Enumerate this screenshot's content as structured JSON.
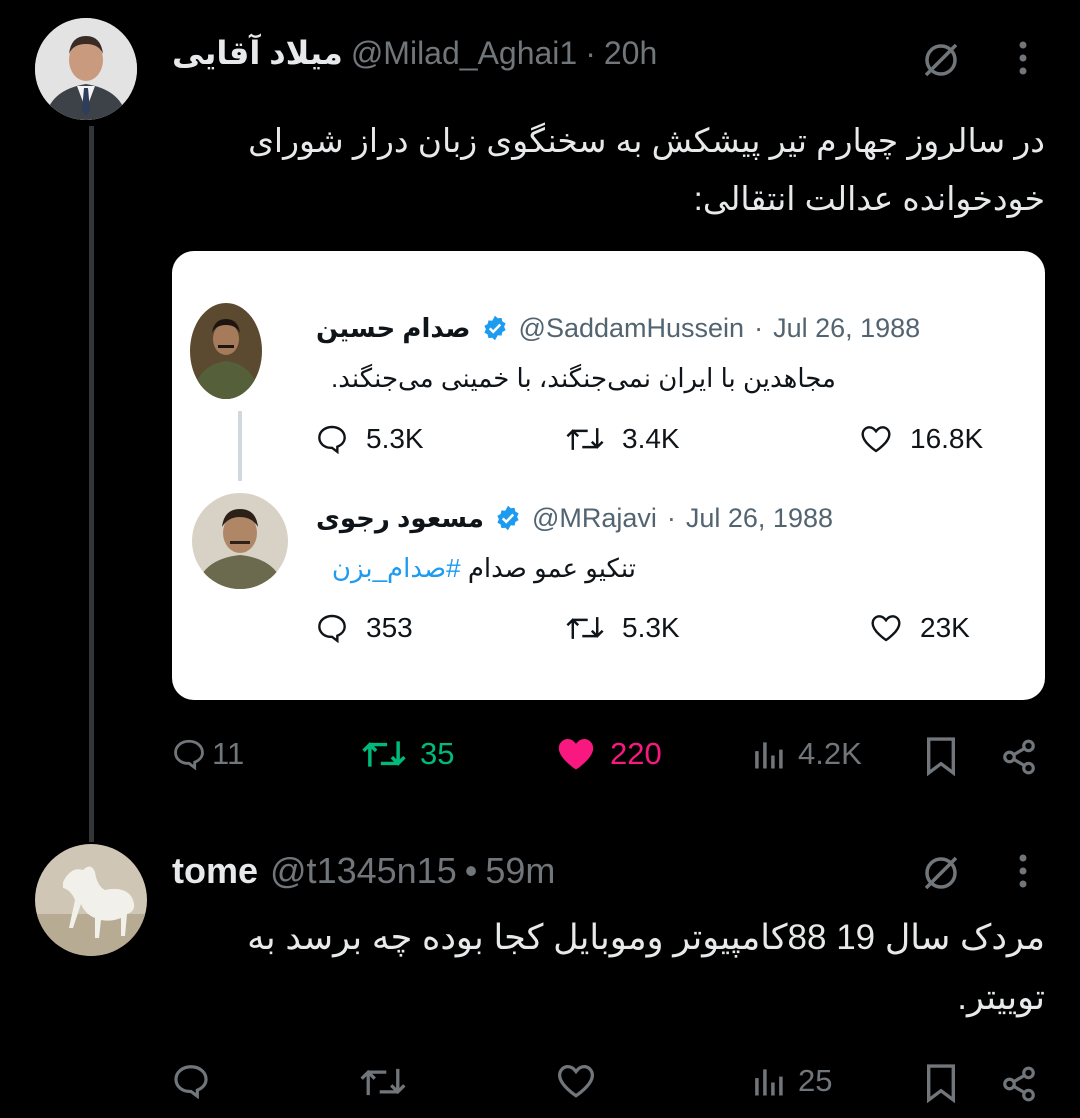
{
  "tweet1": {
    "name": "میلاد آقایی",
    "handle": "@Milad_Aghai1",
    "sep": "·",
    "time": "20h",
    "text_line1": "در سالروز چهارم تیر پیشکش به سخنگوی زبان دراز شورای",
    "text_line2": "خودخوانده عدالت انتقالی:",
    "metrics": {
      "replies": "11",
      "retweets": "35",
      "likes": "220",
      "views": "4.2K"
    },
    "colors": {
      "retweet": "#00ba7c",
      "like": "#f91880"
    }
  },
  "quote_card": {
    "post1": {
      "name": "صدام حسین",
      "handle": "@SaddamHussein",
      "sep": "·",
      "date": "Jul 26, 1988",
      "text": "مجاهدین با ایران نمی‌جنگند، با خمینی می‌جنگند.",
      "replies": "5.3K",
      "retweets": "3.4K",
      "likes": "16.8K"
    },
    "post2": {
      "name": "مسعود رجوی",
      "handle": "@MRajavi",
      "sep": "·",
      "date": "Jul 26, 1988",
      "text": "تنکیو عمو صدام",
      "hashtag": "#صدام_بزن",
      "replies": "353",
      "retweets": "5.3K",
      "likes": "23K"
    },
    "verified_color": "#1d9bf0"
  },
  "tweet2": {
    "name": "tome",
    "handle": "@t1345n15",
    "sep": "•",
    "time": "59m",
    "text_line1": "مردک سال 19 88کامپیوتر وموبایل کجا بوده  چه برسد به",
    "text_line2": "توییتر.",
    "metrics": {
      "views": "25"
    }
  },
  "icons": [
    "grok-icon",
    "more-icon",
    "reply-icon",
    "retweet-icon",
    "like-icon",
    "views-icon",
    "bookmark-icon",
    "share-icon",
    "verified-icon"
  ]
}
